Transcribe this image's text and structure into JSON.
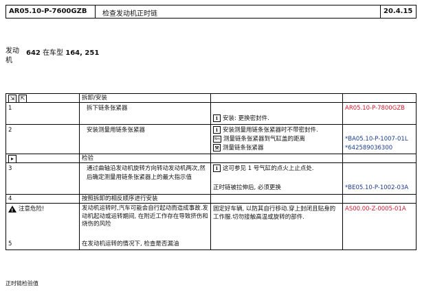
{
  "header": {
    "doc_id": "AR05.10-P-7600GZB",
    "title": "检查发动机正时链",
    "date": "20.4.15"
  },
  "engine": {
    "label": "发动机",
    "model_prefix": "642 在车型",
    "model_list": "164, 251"
  },
  "table": {
    "head_icons": [
      "remove-icon",
      "install-icon"
    ],
    "head_label": "拆卸/安装",
    "rows": {
      "r1": {
        "num": "1",
        "step": "拆下链条张紧器",
        "note": "安装: 更换密封件.",
        "ref": "AR05.10-P-7800GZB"
      },
      "r2": {
        "num": "2",
        "step": "安装测量用链条张紧器",
        "note1": "安装测量用链条张紧器时不带密封件.",
        "note2": "测量链条张紧器到气缸盖的距离",
        "note3": "测量链条张紧器",
        "ref1": "*BA05.10-P-1007-01L",
        "ref2": "*642589036300"
      },
      "check": {
        "label": "检验"
      },
      "r3": {
        "num": "3",
        "step": "通过曲轴沿发动机旋转方向转动发动机两次,然后确定测量用链条张紧器上的最大指示值",
        "note1": "这可参见 1 号气缸的点火上止点处.",
        "note2": "正时链被拉伸后, 必须更换",
        "ref": "*BE05.10-P-1002-03A"
      },
      "r4": {
        "num": "4",
        "step": "按照拆卸的相反顺序进行安装"
      },
      "r5": {
        "num": "5",
        "warn": "注意危险!",
        "step": "发动机运转时,汽车可能会自行起动而造成事故.发动机起动或运转期间, 在附近工作存在导致挤伤和烧伤的风险",
        "note": "固定好车辆, 以防其自行移动.穿上封闭且贴身的工作服.切勿接触高温或旋转的部件.",
        "ref": "AS00.00-Z-0005-01A",
        "step2": "在发动机运转的情况下, 检查是否漏油"
      }
    }
  },
  "footer": {
    "text": "正时链检验值"
  },
  "colors": {
    "red": "#d0182a",
    "blue": "#1a3a8f"
  }
}
